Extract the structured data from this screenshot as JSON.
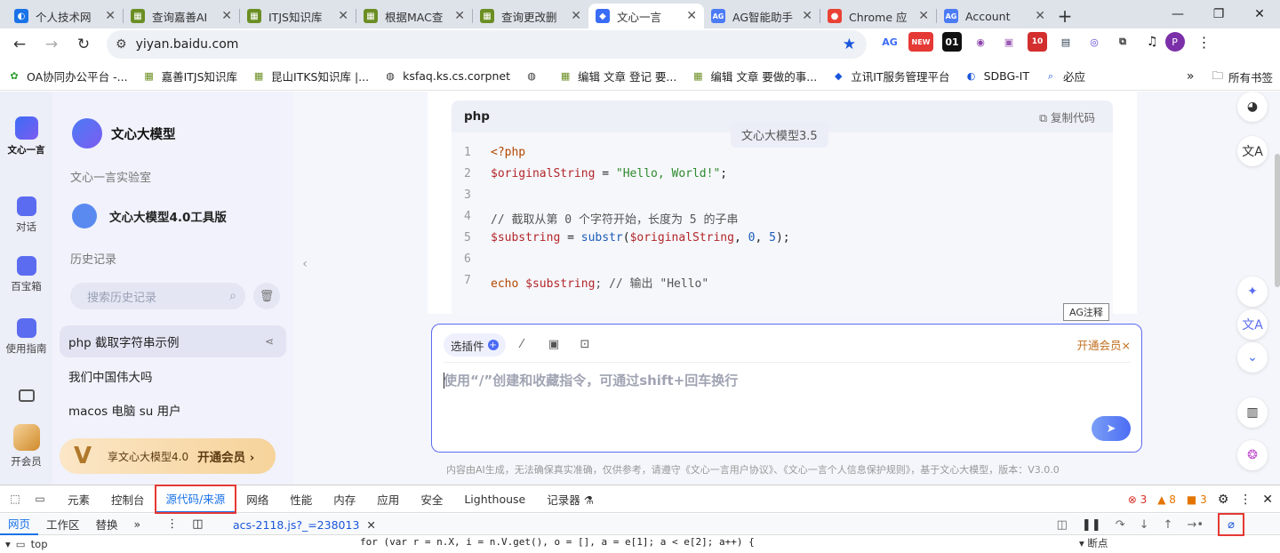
{
  "tabs": [
    {
      "title": "个人技术网",
      "color": "#1a73e8",
      "glyph": "◐"
    },
    {
      "title": "查询嘉善AI",
      "color": "#6b8e23",
      "glyph": "▦"
    },
    {
      "title": "ITJS知识库",
      "color": "#6b8e23",
      "glyph": "▦"
    },
    {
      "title": "根据MAC查",
      "color": "#6b8e23",
      "glyph": "▦"
    },
    {
      "title": "查询更改删",
      "color": "#6b8e23",
      "glyph": "▦"
    },
    {
      "title": "文心一言",
      "color": "#3b6cf6",
      "glyph": "◆",
      "active": true
    },
    {
      "title": "AG智能助手",
      "color": "#4b7bf5",
      "glyph": "AG"
    },
    {
      "title": "Chrome 应",
      "color": "#e94235",
      "glyph": "●"
    },
    {
      "title": "Account",
      "color": "#4b7bf5",
      "glyph": "AG"
    }
  ],
  "address": {
    "url": "yiyan.baidu.com"
  },
  "extensions": [
    {
      "label": "AG",
      "color": "#3b6cf6"
    },
    {
      "label": "NEW",
      "color": "#e53935"
    },
    {
      "label": "01",
      "color": "#111"
    },
    {
      "label": "◉",
      "color": "#8e44ad"
    },
    {
      "label": "▣",
      "color": "#9b59b6"
    },
    {
      "label": "10",
      "color": "#d32f2f"
    },
    {
      "label": "▤",
      "color": "#2c3e50"
    },
    {
      "label": "◎",
      "color": "#5b3fd6"
    },
    {
      "label": "⧉",
      "color": "#333"
    }
  ],
  "profile": {
    "initial": "P"
  },
  "bookmarks": [
    {
      "label": "OA协同办公平台 -...",
      "icon": "✿",
      "color": "#2e9e2e"
    },
    {
      "label": "嘉善ITJS知识库",
      "icon": "▦",
      "color": "#6b8e23"
    },
    {
      "label": "昆山ITKS知识库 |...",
      "icon": "▦",
      "color": "#6b8e23"
    },
    {
      "label": "ksfaq.ks.cs.corpnet",
      "icon": "◍",
      "color": "#333"
    },
    {
      "label": "",
      "icon": "◍",
      "color": "#333"
    },
    {
      "label": "编辑 文章 登记 要...",
      "icon": "▦",
      "color": "#6b8e23"
    },
    {
      "label": "编辑 文章 要做的事...",
      "icon": "▦",
      "color": "#6b8e23"
    },
    {
      "label": "立讯IT服务管理平台",
      "icon": "◆",
      "color": "#1a56db"
    },
    {
      "label": "SDBG-IT",
      "icon": "◐",
      "color": "#1a56db"
    },
    {
      "label": "必应",
      "icon": "⌕",
      "color": "#1a56db"
    }
  ],
  "bookmarks_right": {
    "all": "所有书签"
  },
  "rail": {
    "logo_label": "文心一言",
    "items": [
      {
        "label": "对话",
        "color": "#5b6cf0"
      },
      {
        "label": "百宝箱",
        "color": "#5b6cf0"
      },
      {
        "label": "使用指南",
        "color": "#5b6cf0"
      },
      {
        "label": "",
        "color": "#555"
      },
      {
        "label": "开会员",
        "color": "#d08a2a"
      }
    ]
  },
  "sidebar": {
    "title": "文心大模型",
    "lab": "文心一言实验室",
    "tool": "文心大模型4.0工具版",
    "history_label": "历史记录",
    "search_placeholder": "搜索历史记录",
    "history": [
      {
        "title": "php 截取字符串示例",
        "selected": true
      },
      {
        "title": "我们中国伟大吗"
      },
      {
        "title": "macos 电脑 su 用户"
      }
    ],
    "vip_text": "享文心大模型4.0",
    "vip_action": "开通会员 ›"
  },
  "code": {
    "lang": "php",
    "copy_label": "复制代码",
    "model_tip": "文心大模型3.5",
    "ag_tag": "AG注释",
    "lines": [
      {
        "n": "1",
        "parts": [
          {
            "t": "<?php",
            "c": "kw"
          }
        ]
      },
      {
        "n": "2",
        "parts": [
          {
            "t": "$originalString",
            "c": "var"
          },
          {
            "t": " = ",
            "c": ""
          },
          {
            "t": "\"Hello, World!\"",
            "c": "str"
          },
          {
            "t": ";",
            "c": ""
          }
        ]
      },
      {
        "n": "3",
        "parts": []
      },
      {
        "n": "4",
        "parts": [
          {
            "t": "// 截取从第 0 个字符开始，长度为 5 的子串",
            "c": "cm"
          }
        ]
      },
      {
        "n": "5",
        "parts": [
          {
            "t": "$substring",
            "c": "var"
          },
          {
            "t": " = ",
            "c": ""
          },
          {
            "t": "substr",
            "c": "fn"
          },
          {
            "t": "(",
            "c": ""
          },
          {
            "t": "$originalString",
            "c": "var"
          },
          {
            "t": ", ",
            "c": ""
          },
          {
            "t": "0",
            "c": "num"
          },
          {
            "t": ", ",
            "c": ""
          },
          {
            "t": "5",
            "c": "num"
          },
          {
            "t": ");",
            "c": ""
          }
        ]
      },
      {
        "n": "6",
        "parts": []
      },
      {
        "n": "7",
        "parts": [
          {
            "t": "echo ",
            "c": "kw"
          },
          {
            "t": "$substring",
            "c": "var"
          },
          {
            "t": "; // 输出 \"Hello\"",
            "c": "cm"
          }
        ]
      }
    ]
  },
  "composer": {
    "plugin_label": "选插件",
    "member_label": "开通会员×",
    "placeholder": "使用“/”创建和收藏指令，可通过shift+回车换行"
  },
  "disclaimer": "内容由AI生成，无法确保真实准确，仅供参考，请遵守《文心一言用户协议》、《文心一言个人信息保护规则》，基于文心大模型，版本：V3.0.0",
  "devtools": {
    "tabs": [
      "元素",
      "控制台",
      "源代码/来源",
      "网络",
      "性能",
      "内存",
      "应用",
      "安全",
      "Lighthouse",
      "记录器 ⚗"
    ],
    "active_tab": "源代码/来源",
    "errors": "3",
    "warnings": "8",
    "issues": "3",
    "subtabs": [
      "网页",
      "工作区",
      "替换",
      "»"
    ],
    "file_tab": "acs-2118.js?_=238013",
    "tree_item": "top",
    "source_line": "for (var r = n.X, i = n.V.get(), o = [], a = e[1]; a < e[2]; a++) {",
    "breakpoints_label": "▾ 断点"
  }
}
